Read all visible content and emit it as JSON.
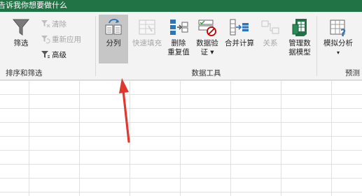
{
  "tell_me": {
    "placeholder": "告诉我你想要做什么"
  },
  "ribbon": {
    "sort_filter_group": {
      "label": "排序和筛选",
      "filter": "筛选",
      "clear": "清除",
      "reapply": "重新应用",
      "advanced": "高级"
    },
    "data_tools_group": {
      "label": "数据工具",
      "text_to_columns": "分列",
      "flash_fill": "快速填充",
      "remove_duplicates_line1": "删除",
      "remove_duplicates_line2": "重复值",
      "data_validation_line1": "数据验",
      "data_validation_line2": "证 ▾",
      "consolidate": "合并计算",
      "relationships": "关系",
      "manage_model_line1": "管理数",
      "manage_model_line2": "据模型"
    },
    "forecast_group": {
      "label": "预测",
      "what_if": "模拟分析",
      "what_if_arrow": "▾"
    }
  },
  "colors": {
    "accent": "#217346",
    "selected": "#c6c6c6",
    "arrow": "#e0382f"
  }
}
